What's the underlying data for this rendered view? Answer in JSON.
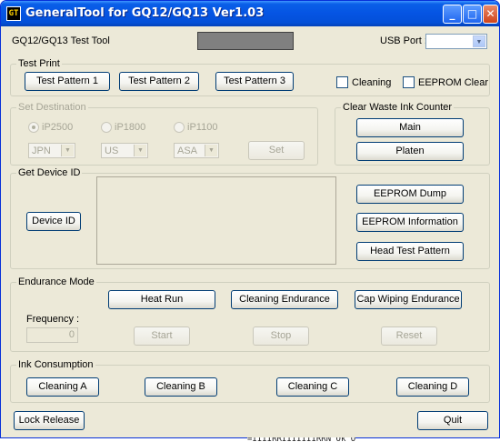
{
  "window": {
    "title": "GeneralTool for GQ12/GQ13 Ver1.03",
    "icon_text": "GT",
    "min_glyph": "_",
    "max_glyph": "□",
    "close_glyph": "✕"
  },
  "header": {
    "app_label": "GQ12/GQ13 Test Tool",
    "usb_port_label": "USB Port :",
    "usb_port_value": ""
  },
  "test_print": {
    "title": "Test Print",
    "pattern1": "Test Pattern 1",
    "pattern2": "Test Pattern 2",
    "pattern3": "Test Pattern 3",
    "cleaning": "Cleaning",
    "eeprom_clear": "EEPROM Clear"
  },
  "set_destination": {
    "title": "Set Destination",
    "radio1": "iP2500",
    "radio2": "iP1800",
    "radio3": "iP1100",
    "select1": "JPN",
    "select2": "US",
    "select3": "ASA",
    "set": "Set"
  },
  "clear_waste": {
    "title": "Clear Waste Ink Counter",
    "main": "Main",
    "platen": "Platen"
  },
  "device_id": {
    "title": "Get Device ID",
    "device_id_button": "Device ID",
    "eeprom_dump": "EEPROM Dump",
    "eeprom_info": "EEPROM Information",
    "head_test": "Head Test Pattern"
  },
  "endurance": {
    "title": "Endurance Mode",
    "heat_run": "Heat Run",
    "cleaning_endurance": "Cleaning Endurance",
    "cap_wiping": "Cap Wiping Endurance",
    "frequency_label": "Frequency :",
    "frequency_value": "0",
    "start": "Start",
    "stop": "Stop",
    "reset": "Reset"
  },
  "ink": {
    "title": "Ink Consumption",
    "cleaning_a": "Cleaning A",
    "cleaning_b": "Cleaning B",
    "cleaning_c": "Cleaning C",
    "cleaning_d": "Cleaning D"
  },
  "footer": {
    "lock_release": "Lock Release",
    "quit": "Quit"
  },
  "background_text": "=IIIIRRIIIIIIIRRN Ok O"
}
